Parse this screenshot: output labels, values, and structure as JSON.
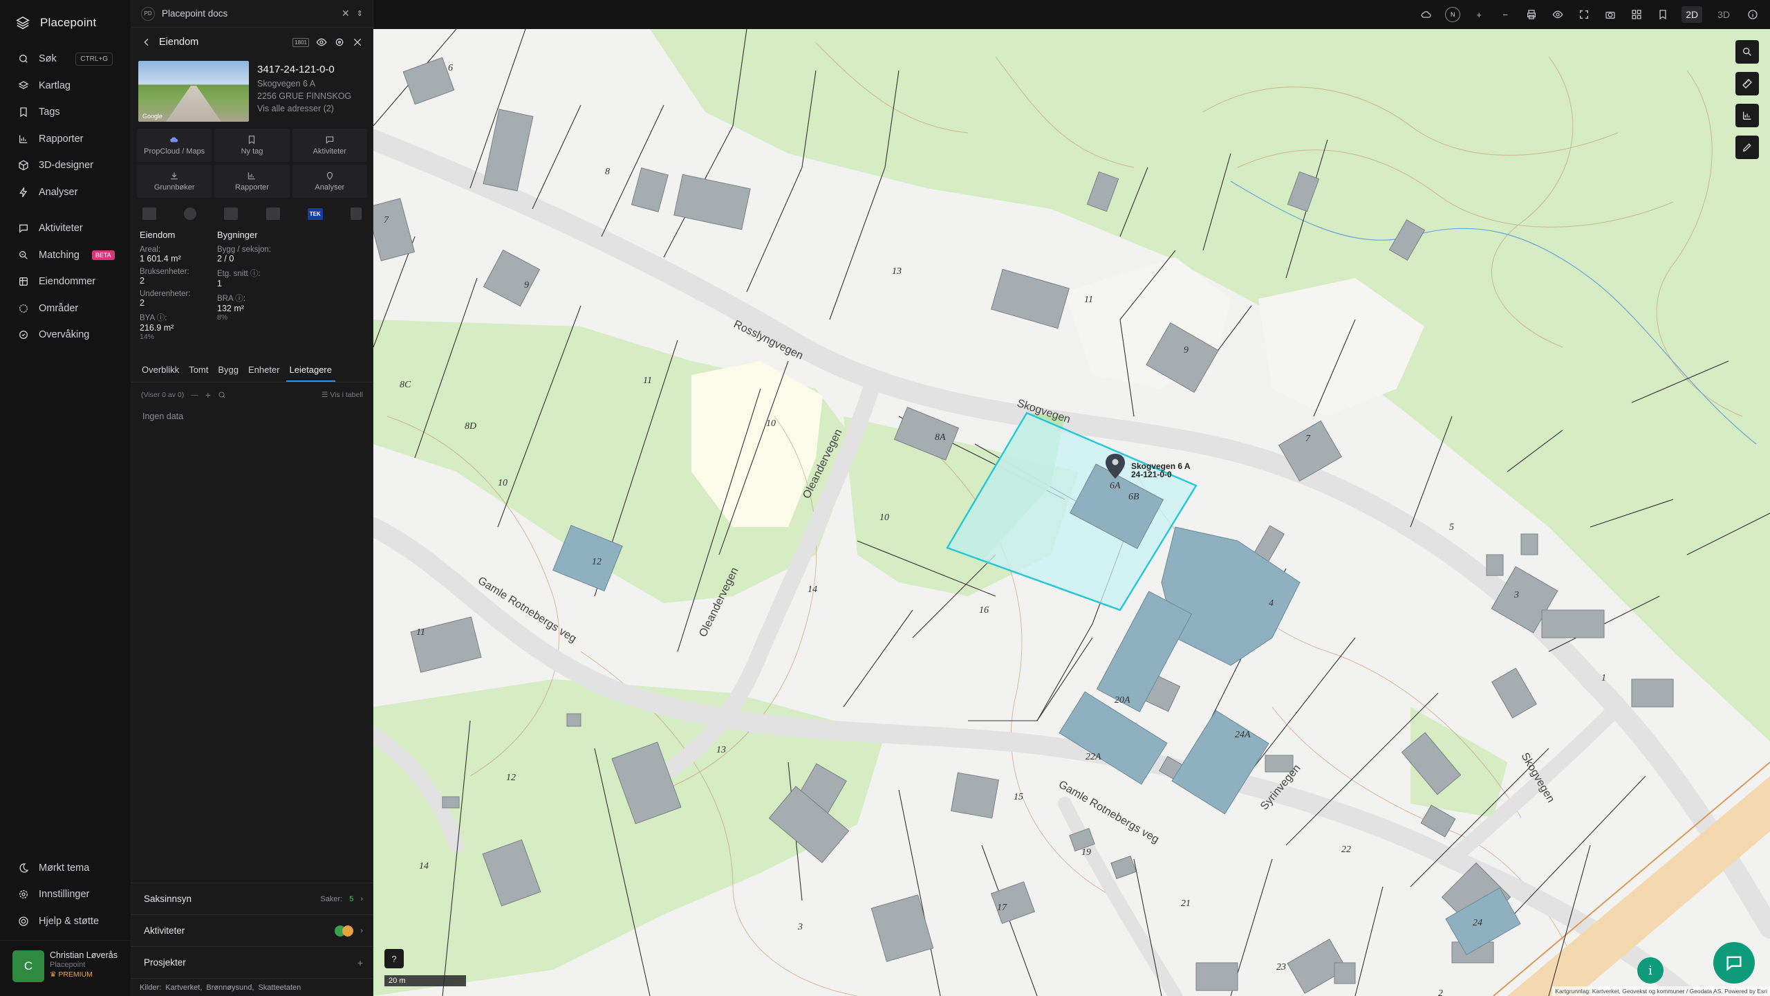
{
  "app": {
    "name": "Placepoint"
  },
  "nav": {
    "items": [
      {
        "label": "Søk",
        "icon": "search-icon",
        "shortcut": "CTRL+G"
      },
      {
        "label": "Kartlag",
        "icon": "layers-icon"
      },
      {
        "label": "Tags",
        "icon": "bookmark-icon"
      },
      {
        "label": "Rapporter",
        "icon": "bar-chart-icon"
      },
      {
        "label": "3D-designer",
        "icon": "cube-icon"
      },
      {
        "label": "Analyser",
        "icon": "bolt-icon"
      }
    ],
    "items2": [
      {
        "label": "Aktiviteter",
        "icon": "chat-icon"
      },
      {
        "label": "Matching",
        "icon": "match-icon",
        "badge": "BETA"
      },
      {
        "label": "Eiendommer",
        "icon": "building-icon"
      },
      {
        "label": "Områder",
        "icon": "area-icon"
      },
      {
        "label": "Overvåking",
        "icon": "monitor-icon"
      }
    ],
    "bottom": [
      {
        "label": "Mørkt tema",
        "icon": "moon-icon"
      },
      {
        "label": "Innstillinger",
        "icon": "gear-icon"
      },
      {
        "label": "Hjelp & støtte",
        "icon": "help-icon"
      }
    ],
    "user": {
      "initial": "C",
      "name": "Christian Løverås",
      "org": "Placepoint",
      "plan": "PREMIUM"
    }
  },
  "panel": {
    "doc": {
      "badge": "PD",
      "title": "Placepoint docs"
    },
    "header": {
      "title": "Eiendom",
      "badge": "1801"
    },
    "property": {
      "id": "3417-24-121-0-0",
      "address_lines": [
        "Skogvegen 6 A",
        "2256 GRUE FINNSKOG",
        "Vis alle adresser (2)"
      ],
      "photo_credit": "Google"
    },
    "actions": [
      {
        "label": "PropCloud / Maps",
        "icon": "cloud-icon"
      },
      {
        "label": "Ny tag",
        "icon": "bookmark-icon"
      },
      {
        "label": "Aktiviteter",
        "icon": "chat-icon"
      },
      {
        "label": "Grunnbøker",
        "icon": "download-icon"
      },
      {
        "label": "Rapporter",
        "icon": "bar-chart-icon"
      },
      {
        "label": "Analyser",
        "icon": "bolt-icon"
      }
    ],
    "tek_label": "TEK",
    "facts": {
      "left_header": "Eiendom",
      "right_header": "Bygninger",
      "left": [
        {
          "k": "Areal:",
          "v": "1 601.4 m²"
        },
        {
          "k": "Bruksenheter:",
          "v": "2"
        },
        {
          "k": "Underenheter:",
          "v": "2"
        },
        {
          "k": "BYA ⓘ:",
          "v": "216.9 m²",
          "p": "14%"
        }
      ],
      "right": [
        {
          "k": "Bygg / seksjon:",
          "v": "2 / 0"
        },
        {
          "k": "Etg. snitt ⓘ:",
          "v": "1"
        },
        {
          "k": "BRA ⓘ:",
          "v": "132 m²",
          "p": "8%"
        }
      ]
    },
    "tabs": [
      "Overblikk",
      "Tomt",
      "Bygg",
      "Enheter",
      "Leietagere"
    ],
    "active_tab": 4,
    "table": {
      "count": "(Viser 0 av 0)",
      "view": "Vis i tabell"
    },
    "empty": "Ingen data",
    "sections": {
      "saksinnsyn": {
        "label": "Saksinnsyn",
        "meta": "Saker:",
        "count": "5"
      },
      "aktiviteter": {
        "label": "Aktiviteter"
      },
      "prosjekter": {
        "label": "Prosjekter"
      }
    },
    "sources": {
      "label": "Kilder:",
      "items": [
        "Kartverket,",
        "Brønnøysund,",
        "Skatteetaten"
      ]
    }
  },
  "topbar": {
    "compass": "N",
    "mode_2d": "2D",
    "mode_3d": "3D"
  },
  "map": {
    "scale": "20 m",
    "attribution": "Kartgrunnlag: Kartverket, Geovekst og kommuner / Geodata AS. Powered by Esri",
    "marker": {
      "line1": "Skogvegen 6 A",
      "line2": "24-121-0-0"
    },
    "roads": [
      "Rosslyngvegen",
      "Skogvegen",
      "Oleandervegen",
      "Gamle Rotnebergs veg",
      "Syrinvegen"
    ],
    "labels": [
      "6",
      "8",
      "7",
      "9",
      "13",
      "11",
      "8C",
      "8D",
      "10",
      "10",
      "10",
      "11",
      "8A",
      "6A",
      "6B",
      "9",
      "7",
      "5",
      "3",
      "1",
      "4",
      "12",
      "14",
      "16",
      "20A",
      "22A",
      "24A",
      "11",
      "12",
      "13",
      "15",
      "14",
      "19",
      "17",
      "21",
      "22",
      "24",
      "23",
      "3",
      "2"
    ]
  },
  "colors": {
    "accent": "#3b8fe6",
    "parcel": "#22c8d8",
    "building": "#8fa5ae",
    "green": "#d6ecc3",
    "fab": "#0d9b7a"
  }
}
